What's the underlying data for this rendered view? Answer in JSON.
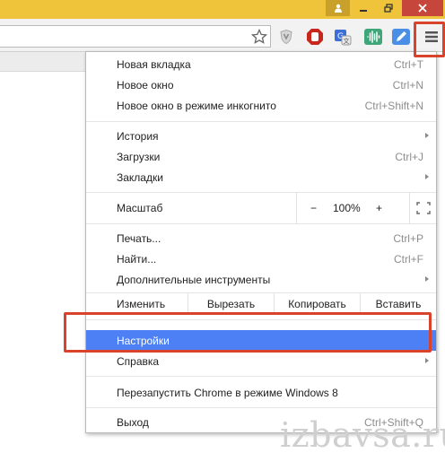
{
  "menu": {
    "new_tab": {
      "label": "Новая вкладка",
      "shortcut": "Ctrl+T"
    },
    "new_window": {
      "label": "Новое окно",
      "shortcut": "Ctrl+N"
    },
    "incognito": {
      "label": "Новое окно в режиме инкогнито",
      "shortcut": "Ctrl+Shift+N"
    },
    "history": {
      "label": "История"
    },
    "downloads": {
      "label": "Загрузки",
      "shortcut": "Ctrl+J"
    },
    "bookmarks": {
      "label": "Закладки"
    },
    "zoom": {
      "label": "Масштаб",
      "minus": "−",
      "value": "100%",
      "plus": "+"
    },
    "print": {
      "label": "Печать...",
      "shortcut": "Ctrl+P"
    },
    "find": {
      "label": "Найти...",
      "shortcut": "Ctrl+F"
    },
    "more_tools": {
      "label": "Дополнительные инструменты"
    },
    "edit": {
      "label": "Изменить",
      "cut": "Вырезать",
      "copy": "Копировать",
      "paste": "Вставить"
    },
    "settings": {
      "label": "Настройки"
    },
    "help": {
      "label": "Справка"
    },
    "relaunch": {
      "label": "Перезапустить Chrome в режиме Windows 8"
    },
    "exit": {
      "label": "Выход",
      "shortcut": "Ctrl+Shift+Q"
    }
  },
  "watermark": "izbavsa.ru",
  "colors": {
    "titlebar": "#efc43a",
    "highlight": "#4c80f4",
    "callout": "#d9432b",
    "close": "#c7463b"
  }
}
